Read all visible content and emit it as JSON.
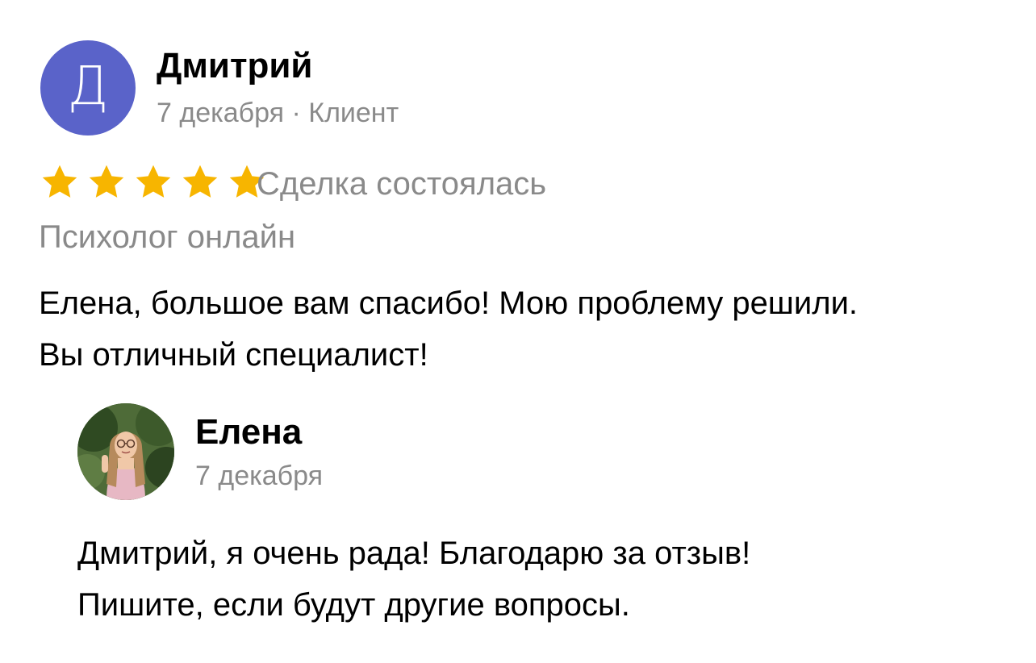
{
  "review": {
    "author": {
      "avatar_letter": "Д",
      "avatar_color": "#5a63c9",
      "name": "Дмитрий",
      "meta": "7 декабря · Клиент"
    },
    "rating": {
      "stars": 5,
      "max": 5,
      "star_color": "#f7b500"
    },
    "deal_status": "Сделка состоялась",
    "service": "Психолог онлайн",
    "text_lines": [
      "Елена, большое вам спасибо! Мою проблему решили.",
      "Вы отличный специалист!"
    ]
  },
  "reply": {
    "author": {
      "avatar": "user-photo",
      "name": "Елена",
      "date": "7 декабря"
    },
    "text_lines": [
      "Дмитрий, я очень рада! Благодарю за отзыв!",
      "Пишите, если будут другие вопросы."
    ]
  }
}
